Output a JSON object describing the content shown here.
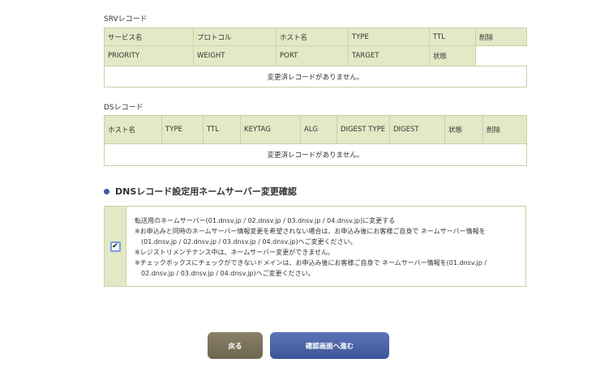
{
  "srv": {
    "label": "SRVレコード",
    "headers1": [
      "サービス名",
      "プロトコル",
      "ホスト名",
      "TYPE",
      "TTL",
      "削除"
    ],
    "headers2": [
      "PRIORITY",
      "WEIGHT",
      "PORT",
      "TARGET",
      "状態"
    ],
    "empty": "変更済レコードがありません。"
  },
  "ds": {
    "label": "DSレコード",
    "headers": [
      "ホスト名",
      "TYPE",
      "TTL",
      "KEYTAG",
      "ALG",
      "DIGEST TYPE",
      "DIGEST",
      "状態",
      "削除"
    ],
    "empty": "変更済レコードがありません。"
  },
  "ns_confirm": {
    "heading": "DNSレコード設定用ネームサーバー変更確認",
    "checked": true,
    "checkmark": "✔",
    "lines": [
      "転送用のネームサーバー(01.dnsv.jp / 02.dnsv.jp / 03.dnsv.jp / 04.dnsv.jp)に変更する",
      "※お申込みと同時のネームサーバー情報変更を希望されない場合は、お申込み後にお客様ご自身で ネームサーバー情報を",
      "(01.dnsv.jp / 02.dnsv.jp / 03.dnsv.jp / 04.dnsv.jp)へご変更ください。",
      "※レジストリメンテナンス中は、ネームサーバー変更ができません。",
      "※チェックボックスにチェックができないドメインは、お申込み後にお客様ご自身で ネームサーバー情報を(01.dnsv.jp /",
      "02.dnsv.jp / 03.dnsv.jp / 04.dnsv.jp)へご変更ください。"
    ]
  },
  "buttons": {
    "back": "戻る",
    "next": "確認画面へ進む"
  }
}
